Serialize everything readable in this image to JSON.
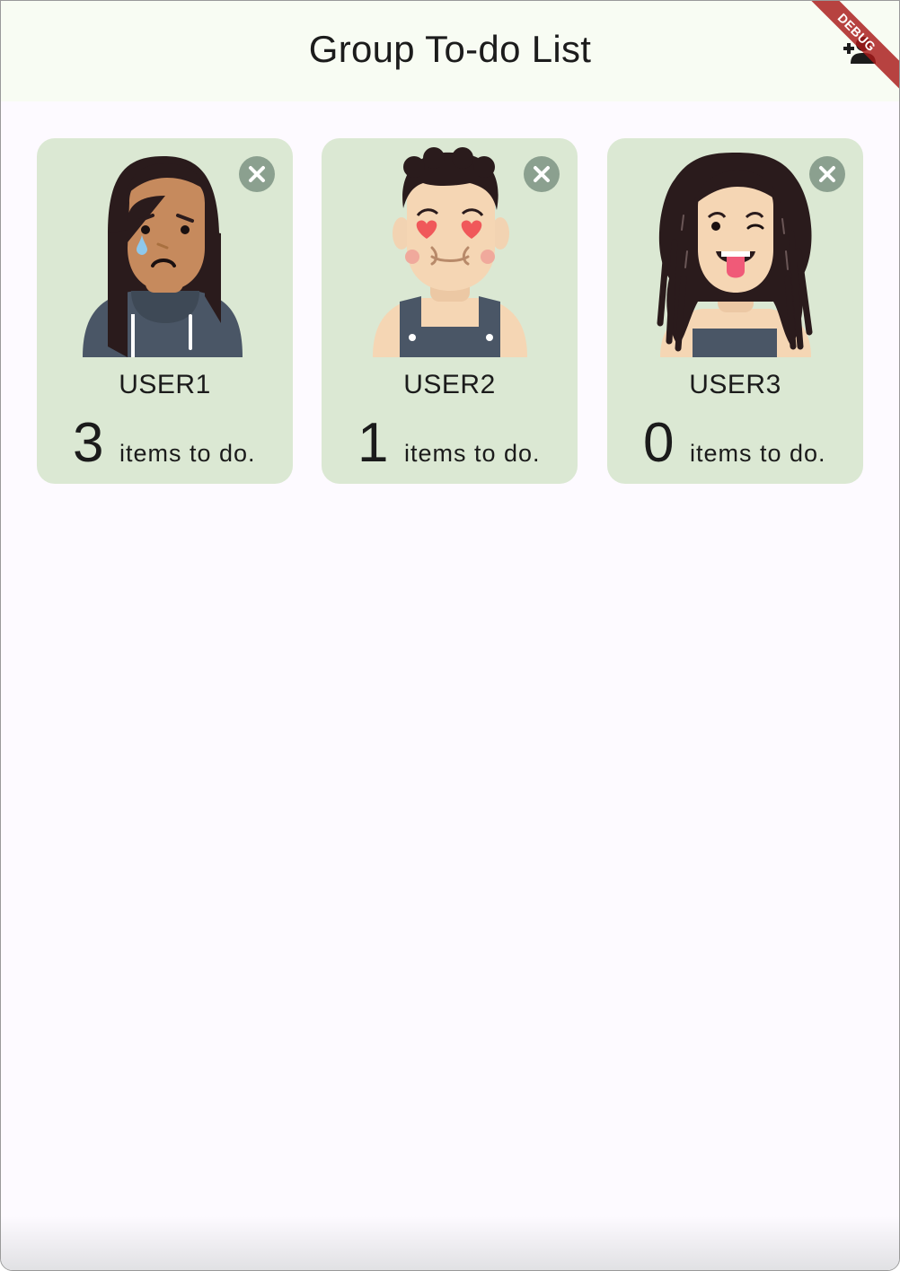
{
  "app": {
    "title": "Group To-do List",
    "debug_label": "DEBUG",
    "add_user_icon": "person-add-icon"
  },
  "users": [
    {
      "name": "USER1",
      "count": "3",
      "count_label": "items to do.",
      "avatar": "sad-crying-woman-avatar",
      "remove_icon": "close-circle-icon"
    },
    {
      "name": "USER2",
      "count": "1",
      "count_label": "items to do.",
      "avatar": "heart-eyes-man-avatar",
      "remove_icon": "close-circle-icon"
    },
    {
      "name": "USER3",
      "count": "0",
      "count_label": "items to do.",
      "avatar": "tongue-out-curly-hair-woman-avatar",
      "remove_icon": "close-circle-icon"
    }
  ],
  "colors": {
    "card_background": "#dbe8d3",
    "remove_button": "#8ba08f",
    "appbar_background": "#f8fcf3",
    "page_background": "#fdfaff",
    "debug_ribbon": "#a81818"
  }
}
